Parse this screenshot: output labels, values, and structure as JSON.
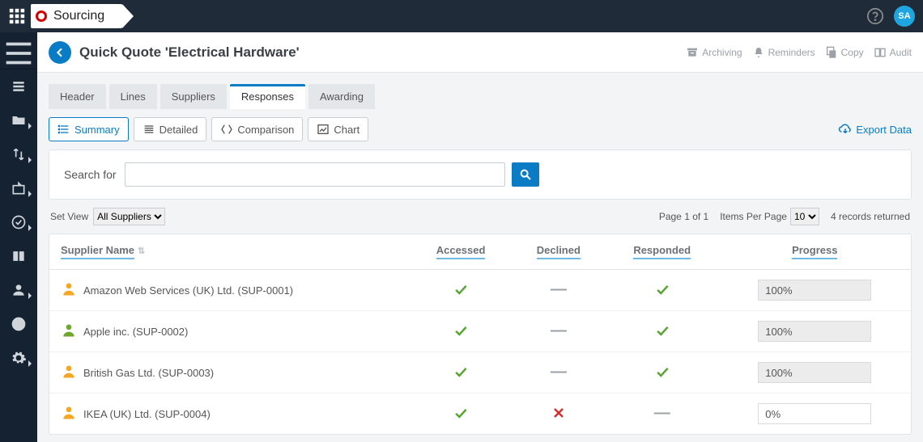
{
  "brand": "Sourcing",
  "avatar_initials": "SA",
  "page_title": "Quick Quote 'Electrical Hardware'",
  "header_actions": {
    "archiving": "Archiving",
    "reminders": "Reminders",
    "copy": "Copy",
    "audit": "Audit"
  },
  "tabs": [
    "Header",
    "Lines",
    "Suppliers",
    "Responses",
    "Awarding"
  ],
  "active_tab_index": 3,
  "views": {
    "summary": "Summary",
    "detailed": "Detailed",
    "comparison": "Comparison",
    "chart": "Chart"
  },
  "active_view": "summary",
  "export_label": "Export Data",
  "search": {
    "label": "Search for",
    "value": ""
  },
  "set_view": {
    "label": "Set View",
    "options": [
      "All Suppliers"
    ],
    "selected": "All Suppliers"
  },
  "pagination": {
    "page_text": "Page 1 of 1",
    "ipp_label": "Items Per Page",
    "ipp_options": [
      "10"
    ],
    "ipp_selected": "10",
    "records_text": "4 records returned"
  },
  "columns": {
    "supplier": "Supplier Name",
    "accessed": "Accessed",
    "declined": "Declined",
    "responded": "Responded",
    "progress": "Progress"
  },
  "rows": [
    {
      "icon": "orange",
      "name": "Amazon Web Services (UK) Ltd. (SUP-0001)",
      "accessed": "tick",
      "declined": "dash",
      "responded": "tick",
      "progress": "100%"
    },
    {
      "icon": "green",
      "name": "Apple inc. (SUP-0002)",
      "accessed": "tick",
      "declined": "dash",
      "responded": "tick",
      "progress": "100%"
    },
    {
      "icon": "orange",
      "name": "British Gas Ltd. (SUP-0003)",
      "accessed": "tick",
      "declined": "dash",
      "responded": "tick",
      "progress": "100%"
    },
    {
      "icon": "orange",
      "name": "IKEA (UK) Ltd. (SUP-0004)",
      "accessed": "tick",
      "declined": "cross",
      "responded": "dash",
      "progress": "0%"
    }
  ]
}
